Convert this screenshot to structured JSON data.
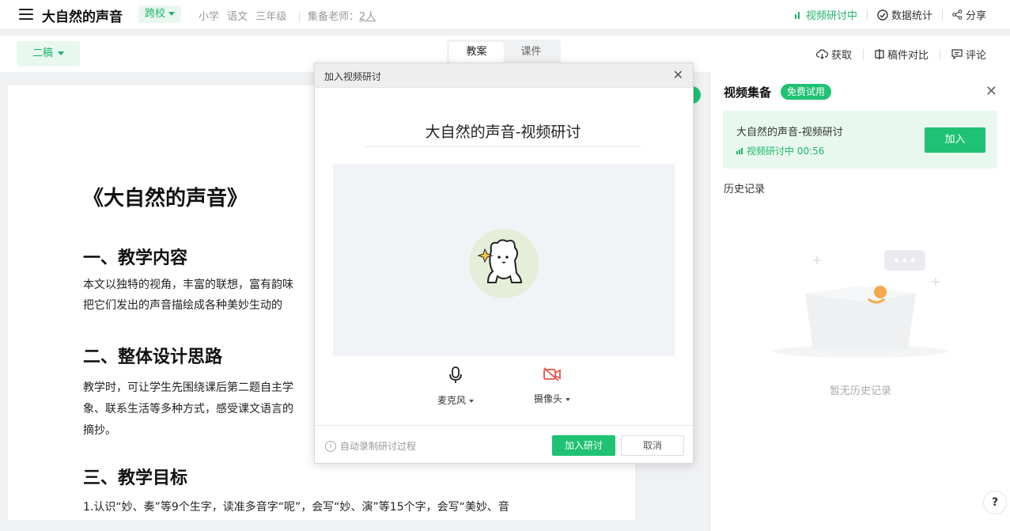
{
  "topbar": {
    "title": "大自然的声音",
    "school_tag": "跨校",
    "meta": [
      "小学",
      "语文",
      "三年级"
    ],
    "teachers_label": "集备老师：",
    "teachers_count": "2人",
    "live_status": "视频研讨中",
    "stats": "数据统计",
    "share": "分享"
  },
  "subbar": {
    "draft": "二稿",
    "tabs": [
      "教案",
      "课件"
    ],
    "get": "获取",
    "compare": "稿件对比",
    "comment": "评论"
  },
  "doc": {
    "title": "《大自然的声音》",
    "sections": [
      {
        "heading": "一、教学内容",
        "text": "本文以独特的视角，丰富的联想，富有韵味\n把它们发出的声音描绘成各种美妙生动的"
      },
      {
        "heading": "二、整体设计思路",
        "text": "教学时，可让学生先围绕课后第二题自主学\n象、联系生活等多种方式，感受课文语言的\n摘抄。"
      },
      {
        "heading": "三、教学目标",
        "text": "1.认识“妙、奏”等9个生字，读准多音字“呢”，会写“妙、演”等15个字，会写“美妙、音"
      }
    ]
  },
  "right_panel": {
    "title": "视频集备",
    "trial": "免费试用",
    "card_name": "大自然的声音-视频研讨",
    "card_status": "视频研讨中 00:56",
    "join": "加入",
    "history": "历史记录",
    "empty": "暂无历史记录"
  },
  "dialog": {
    "title": "加入视频研讨",
    "room_name": "大自然的声音-视频研讨",
    "mic": "麦克风",
    "camera": "摄像头",
    "auto_record": "自动录制研讨过程",
    "join_btn": "加入研讨",
    "cancel_btn": "取消"
  },
  "colors": {
    "accent": "#1fc272",
    "accent_light": "#e8f8ef",
    "camera_off": "#e8534a"
  }
}
